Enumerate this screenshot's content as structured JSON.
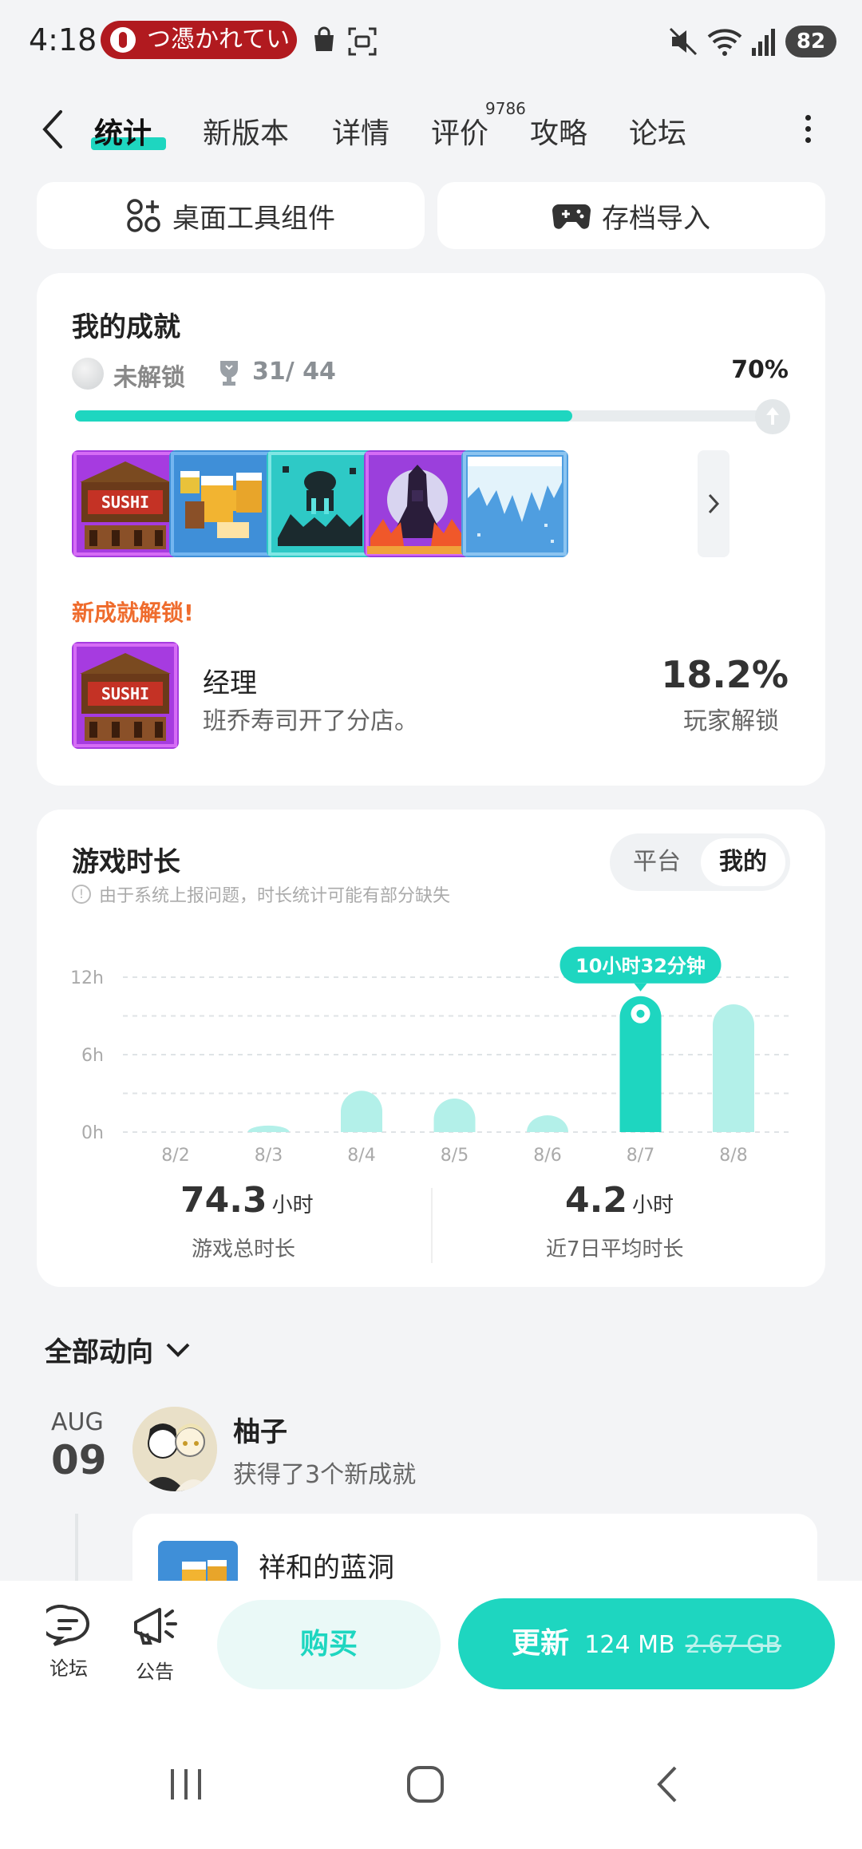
{
  "status_bar": {
    "time": "4:18",
    "notification_text": "つ憑かれてい",
    "battery": "82"
  },
  "nav": {
    "tabs": [
      {
        "label": "统计"
      },
      {
        "label": "新版本"
      },
      {
        "label": "详情"
      },
      {
        "label": "评价"
      },
      {
        "label": "攻略"
      },
      {
        "label": "论坛"
      }
    ],
    "review_count": "9786"
  },
  "quick_actions": {
    "widget_label": "桌面工具组件",
    "save_import_label": "存档导入"
  },
  "achievements": {
    "title": "我的成就",
    "locked_label": "未解锁",
    "progress_text": "31/ 44",
    "progress_percent_text": "70%",
    "progress_fraction": 0.7,
    "new_unlock_label": "新成就解锁!",
    "latest": {
      "name": "经理",
      "description": "班乔寿司开了分店。",
      "percent": "18.2%",
      "percent_label": "玩家解锁"
    }
  },
  "playtime": {
    "title": "游戏时长",
    "notice": "由于系统上报问题，时长统计可能有部分缺失",
    "segment": {
      "platform": "平台",
      "mine": "我的"
    },
    "total_value": "74.3",
    "total_unit": "小时",
    "total_label": "游戏总时长",
    "avg_value": "4.2",
    "avg_unit": "小时",
    "avg_label": "近7日平均时长"
  },
  "chart_data": {
    "type": "bar",
    "categories": [
      "8/2",
      "8/3",
      "8/4",
      "8/5",
      "8/6",
      "8/7",
      "8/8"
    ],
    "values": [
      0,
      0.5,
      3.2,
      2.6,
      1.3,
      10.53,
      9.9
    ],
    "ylim": [
      0,
      12
    ],
    "yticks": [
      "0h",
      "6h",
      "12h"
    ],
    "highlight_index": 5,
    "tooltip": "10小时32分钟",
    "colors": {
      "bar": "#b3f0e9",
      "highlight": "#1ed6c0"
    }
  },
  "feed": {
    "filter_label": "全部动向",
    "month": "AUG",
    "day": "09",
    "user": "柚子",
    "action": "获得了3个新成就",
    "card_title": "祥和的蓝洞"
  },
  "bottom_bar": {
    "forum_label": "论坛",
    "announce_label": "公告",
    "buy_label": "购买",
    "update_label": "更新",
    "update_size": "124 MB",
    "update_old_size": "2.67 GB"
  },
  "colors": {
    "accent": "#1ed6c0",
    "new_unlock": "#ef6c2d",
    "notification": "#b11a1f"
  }
}
